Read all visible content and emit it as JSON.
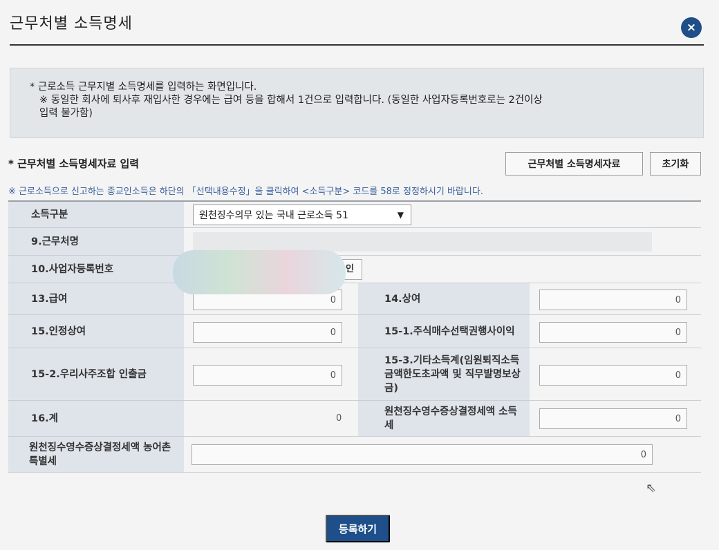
{
  "modal": {
    "title": "근무처별 소득명세",
    "close_glyph": "×"
  },
  "notice": {
    "line1": "* 근로소득 근무지별 소득명세를 입력하는 화면입니다.",
    "line2": "※ 동일한 회사에 퇴사후 재입사한 경우에는 급여 등을 합해서 1건으로 입력합니다. (동일한 사업자등록번호로는 2건이상",
    "line3": "입력 불가함)"
  },
  "section": {
    "title": "* 근무처별 소득명세자료 입력",
    "data_button": "근무처별 소득명세자료",
    "reset_button": "초기화",
    "warning": "※ 근로소득으로 신고하는 종교인소득은 하단의 「선택내용수정」을 클릭하여 <소득구분> 코드를 58로 정정하시기 바랍니다."
  },
  "form": {
    "income_type_label": "소득구분",
    "income_type_value": "원천징수의무 있는 국내 근로소득 51",
    "workplace_label": "9.근무처명",
    "bizno_label": "10.사업자등록번호",
    "bizno_confirm": "인",
    "salary_label": "13.급여",
    "salary_value": "0",
    "bonus_label": "14.상여",
    "bonus_value": "0",
    "deemed_bonus_label": "15.인정상여",
    "deemed_bonus_value": "0",
    "stock_option_label": "15-1.주식매수선택권행사이익",
    "stock_option_value": "0",
    "esop_label": "15-2.우리사주조합 인출금",
    "esop_value": "0",
    "other_income_label": "15-3.기타소득계(임원퇴직소득금액한도초과액 및 직무발명보상금)",
    "other_income_value": "0",
    "total_label": "16.계",
    "total_value": "0",
    "income_tax_label": "원천징수영수증상결정세액 소득세",
    "income_tax_value": "0",
    "rural_tax_label": "원천징수영수증상결정세액 농어촌특별세",
    "rural_tax_value": "0"
  },
  "footer": {
    "submit_label": "등록하기"
  },
  "colors": {
    "primary": "#1e4f8a",
    "label_bg": "#dfe3ea",
    "notice_bg": "#e3e6e8",
    "warning_text": "#3a5f9e"
  }
}
